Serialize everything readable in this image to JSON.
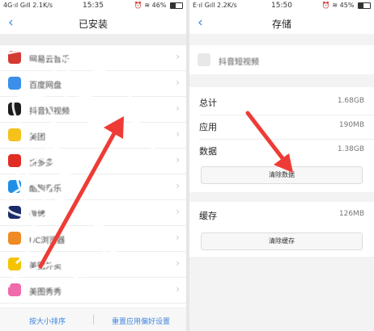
{
  "left_status": {
    "network": "4G·ıl Gıll 2.1K/s",
    "time": "15:35",
    "battery_pct": "46%",
    "battery_level": 0.46
  },
  "right_status": {
    "network": "E·ıl Gıll 2.2K/s",
    "time": "15:50",
    "battery_pct": "45%",
    "battery_level": 0.45
  },
  "installed": {
    "title": "已安装",
    "apps": [
      {
        "name": "网易云音乐",
        "color": "#d33a31"
      },
      {
        "name": "百度网盘",
        "color": "#3b8fe8"
      },
      {
        "name": "抖音短视频",
        "color": "#1c1c1c"
      },
      {
        "name": "美团",
        "color": "#f4c21b"
      },
      {
        "name": "拼多多",
        "color": "#e02e24"
      },
      {
        "name": "酷狗音乐",
        "color": "#1f8fe6"
      },
      {
        "name": "微博",
        "color": "#1c2b6a"
      },
      {
        "name": "UC浏览器",
        "color": "#f08a24"
      },
      {
        "name": "美团外卖",
        "color": "#f5c400"
      },
      {
        "name": "美图秀秀",
        "color": "#f06bab"
      }
    ],
    "sort_label": "按大小排序",
    "reset_label": "重置应用偏好设置"
  },
  "storage": {
    "title": "存储",
    "app_name": "抖音短视频",
    "rows": [
      {
        "label": "总计",
        "value": "1.68GB"
      },
      {
        "label": "应用",
        "value": "190MB"
      },
      {
        "label": "数据",
        "value": "1.38GB"
      }
    ],
    "clear_data_label": "清除数据",
    "cache_label": "缓存",
    "cache_value": "126MB",
    "clear_cache_label": "清除缓存"
  },
  "icons": {
    "back": "‹",
    "chevron": "›"
  }
}
